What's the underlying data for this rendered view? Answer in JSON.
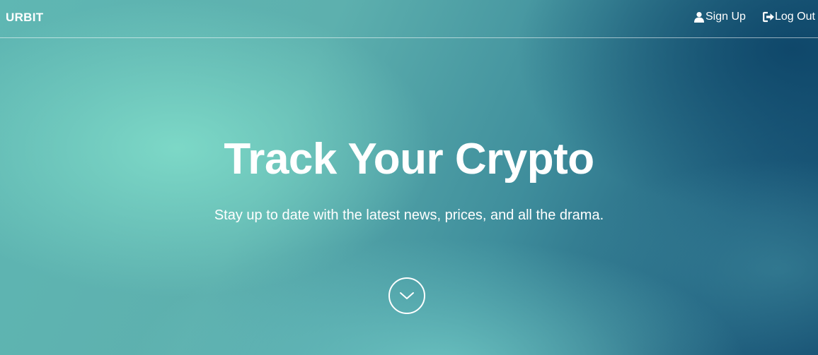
{
  "navbar": {
    "brand": "URBIT",
    "links": [
      {
        "label": "Sign Up",
        "icon": "user-icon"
      },
      {
        "label": "Log Out",
        "icon": "sign-out-icon"
      }
    ]
  },
  "hero": {
    "title": "Track Your Crypto",
    "subtitle": "Stay up to date with the latest news, prices, and all the drama.",
    "scroll_icon": "chevron-down-icon"
  },
  "colors": {
    "text": "#ffffff",
    "teal_light": "#7edac8",
    "teal_mid": "#5db0ae",
    "navy_dark": "#164f72"
  }
}
